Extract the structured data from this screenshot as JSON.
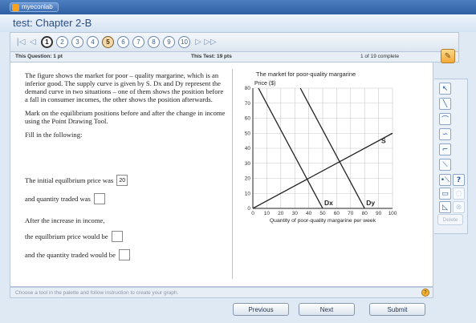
{
  "app": {
    "brand": "myeconlab",
    "title": "test: Chapter 2-B"
  },
  "question_nav": {
    "questions": [
      "1",
      "2",
      "3",
      "4",
      "5",
      "6",
      "7",
      "8",
      "9",
      "10"
    ],
    "current": "1",
    "visited": "5"
  },
  "info": {
    "this_question": "This Question: 1 pt",
    "this_test": "This Test: 19 pts",
    "progress": "1 of 19 complete"
  },
  "question": {
    "paragraphs": [
      "The figure shows the market for poor – quality margarine, which is an inferior good. The supply curve is given by S. Dx and Dy represent the demand curve in two situations – one of them shows the position before a fall in consumer incomes, the other shows the position afterwards.",
      "Mark on the equilibrium positions before and after the change in income using the Point Drawing Tool.",
      "Fill in the following:"
    ],
    "fill": [
      {
        "label": "The initial equilbrium price was",
        "value": "20"
      },
      {
        "label": "and quantity traded was",
        "value": ""
      },
      {
        "label": "After the increase in income,",
        "value": null
      },
      {
        "label": "the equilbrium price would be",
        "value": ""
      },
      {
        "label": "and the quantity traded would be",
        "value": ""
      }
    ]
  },
  "chart_data": {
    "type": "line",
    "title": "The market for poor-quality margarine",
    "ylabel": "Price ($)",
    "xlabel": "Quantity of poor-quality margarine per week",
    "xlim": [
      0,
      100
    ],
    "ylim": [
      0,
      80
    ],
    "x_ticks": [
      0,
      10,
      20,
      30,
      40,
      50,
      60,
      70,
      80,
      90,
      100
    ],
    "y_ticks": [
      0,
      10,
      20,
      30,
      40,
      50,
      60,
      70,
      80
    ],
    "grid": true,
    "series": [
      {
        "name": "S",
        "x": [
          0,
          100
        ],
        "y": [
          0,
          50
        ]
      },
      {
        "name": "Dx",
        "x": [
          4,
          50
        ],
        "y": [
          80,
          0
        ]
      },
      {
        "name": "Dy",
        "x": [
          34,
          80
        ],
        "y": [
          80,
          0
        ]
      }
    ],
    "colors": {
      "lines": "#222222",
      "grid": "#c8c8c8"
    }
  },
  "hint": "Choose a tool in the palette and follow instruction to create your graph.",
  "buttons": {
    "previous": "Previous",
    "next": "Next",
    "submit": "Submit"
  },
  "palette": {
    "tools": [
      "pointer-icon",
      "line-icon",
      "curve-icon",
      "multi-curve-icon",
      "polyline-icon",
      "segment-icon",
      "point-icon",
      "rectangle-icon",
      "label-icon"
    ],
    "help_label": "?",
    "delete_label": "Delete"
  },
  "colors": {
    "accent": "#2e5fa3",
    "highlight": "#f4d9a8"
  }
}
